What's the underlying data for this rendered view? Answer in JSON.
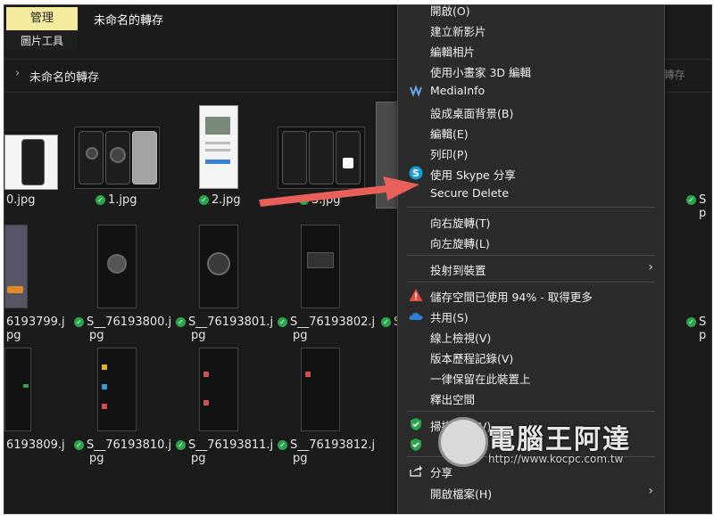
{
  "ribbon": {
    "manage_tab": "管理",
    "picture_tools_tab": "圖片工具",
    "window_title": "未命名的轉存"
  },
  "address_bar": {
    "chevron": "›",
    "crumb": "未命名的轉存",
    "search_placeholder": "l轉存"
  },
  "files": [
    {
      "name": "0.jpg",
      "line2": ""
    },
    {
      "name": "1.jpg",
      "line2": ""
    },
    {
      "name": "2.jpg",
      "line2": ""
    },
    {
      "name": "3.jpg",
      "line2": ""
    },
    {
      "name": "6193799.j",
      "line2": "pg"
    },
    {
      "name": "S__76193800.j",
      "line2": "pg"
    },
    {
      "name": "S__76193801.j",
      "line2": "pg"
    },
    {
      "name": "S__76193802.j",
      "line2": "pg"
    },
    {
      "name": "6193809.j",
      "line2": "pg"
    },
    {
      "name": "S__76193810.j",
      "line2": "pg"
    },
    {
      "name": "S__76193811.j",
      "line2": "pg"
    },
    {
      "name": "S__76193812.j",
      "line2": "pg"
    }
  ],
  "right_labels": {
    "a": "S",
    "a2": "p",
    "b": "S",
    "b2": "p",
    "c": "S",
    "c2": "p",
    "d": "S",
    "e": "S"
  },
  "context_menu": {
    "items": [
      {
        "label": "開啟(O)"
      },
      {
        "label": "建立新影片"
      },
      {
        "label": "編輯相片"
      },
      {
        "label": "使用小畫家 3D 編輯"
      },
      {
        "label": "MediaInfo"
      },
      {
        "label": "設成桌面背景(B)"
      },
      {
        "label": "編輯(E)"
      },
      {
        "label": "列印(P)"
      },
      {
        "label": "使用 Skype 分享"
      },
      {
        "label": "Secure Delete"
      },
      {
        "label": "向右旋轉(T)"
      },
      {
        "label": "向左旋轉(L)"
      },
      {
        "label": "投射到裝置"
      },
      {
        "label": "儲存空間已使用 94% - 取得更多"
      },
      {
        "label": "共用(S)"
      },
      {
        "label": "線上檢視(V)"
      },
      {
        "label": "版本歷程記錄(V)"
      },
      {
        "label": "一律保留在此裝置上"
      },
      {
        "label": "釋出空間"
      },
      {
        "label": "掃描病毒(V)"
      },
      {
        "label": "分享"
      },
      {
        "label": "開啟檔案(H)"
      }
    ]
  },
  "watermark": {
    "text": "電腦王阿達",
    "url": "http://www.kocpc.com.tw"
  },
  "colors": {
    "manage_tab_bg": "#f3eb9b",
    "arrow": "#e9605a",
    "check": "#2da44e",
    "warning": "#e74c3c",
    "skype": "#1a9ad6",
    "onedrive": "#2f7fd6",
    "defender": "#2da44e"
  }
}
